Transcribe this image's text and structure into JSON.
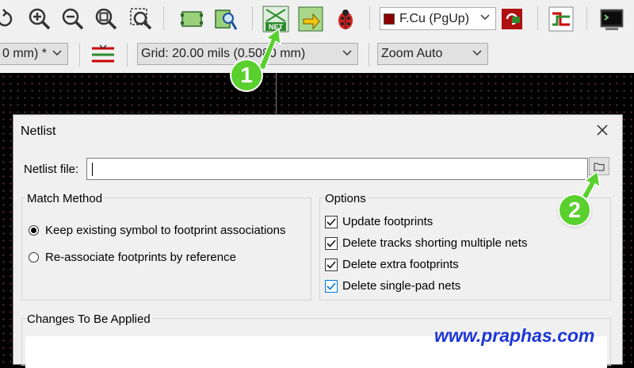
{
  "toolbar": {
    "layer_select": "F.Cu (PgUp)",
    "unit_select": "0 mm) *",
    "grid_select": "Grid: 20.00 mils (0.5080 mm)",
    "zoom_select": "Zoom Auto",
    "net_icon_label": "NET"
  },
  "annotations": {
    "step1": "1",
    "step2": "2"
  },
  "dialog": {
    "title": "Netlist",
    "netlist_file_label": "Netlist file:",
    "netlist_file_value": "",
    "match_method": {
      "title": "Match Method",
      "options": [
        {
          "label": "Keep existing symbol to footprint associations",
          "selected": true
        },
        {
          "label": "Re-associate footprints by reference",
          "selected": false
        }
      ]
    },
    "options": {
      "title": "Options",
      "items": [
        {
          "label": "Update footprints",
          "checked": true
        },
        {
          "label": "Delete tracks shorting multiple nets",
          "checked": true
        },
        {
          "label": "Delete extra footprints",
          "checked": true
        },
        {
          "label": "Delete single-pad nets",
          "checked": true
        }
      ]
    },
    "changes_title": "Changes To Be Applied"
  },
  "watermark": "www.praphas.com",
  "colors": {
    "accent": "#0078d7",
    "badge": "#5ad02e",
    "watermark": "#1d36d8",
    "layer_swatch": "#8b0000"
  }
}
